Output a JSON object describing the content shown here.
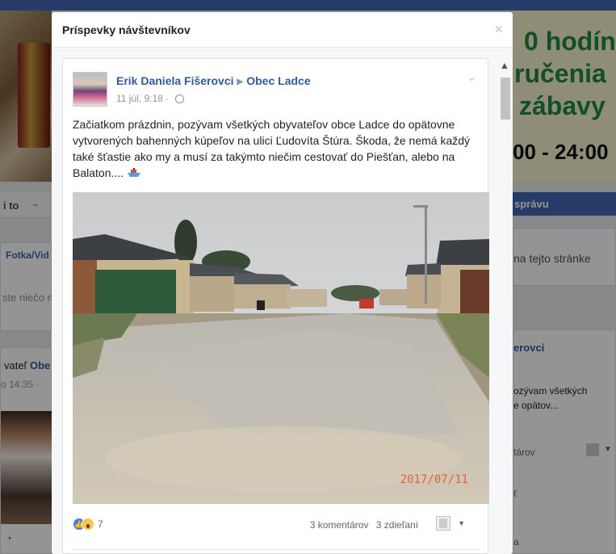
{
  "modal": {
    "title": "Príspevky návštevníkov",
    "close_glyph": "×"
  },
  "post": {
    "author": "Erik Daniela Fišerovci",
    "separator": "▶",
    "target": "Obec Ladce",
    "timestamp": "11 júl, 9:18",
    "dot": "·",
    "privacy_icon": "globe-icon",
    "menu_glyph": "⌄",
    "text": "Začiatkom prázdnin, pozývam všetkých obyvateľov obce Ladce do opätovne vytvorených bahenných kúpeľov na ulici Ľudovíta Štúra. Škoda, že nemá každý také šťastie ako my a musí za takýmto niečim cestovať do Piešťan, alebo na Balaton....",
    "emoji": "boat-emoji",
    "photo_date": "2017/07/11",
    "reactions": {
      "like_glyph": "👍",
      "count": "7",
      "types": [
        "like",
        "wow"
      ]
    },
    "comments": "3 komentárov",
    "shares": "3 zdieľaní"
  },
  "background": {
    "banner_line1": "0 hodín",
    "banner_line2": "ručenia",
    "banner_line3": "zábavy",
    "banner_line4": "00 - 24:00",
    "left_strip_label": "i to",
    "left_card_tab": "Fotka/Vid",
    "left_card_prompt": "ste niečo n",
    "left_post_line": "vateľ",
    "left_post_link": "Obe",
    "left_post_time": "o 14:35 ·",
    "right_button": "správu",
    "right_search": "na tejto stránke",
    "right_author": "erovci",
    "right_preview": "ozývam všetkých\ne opätov...",
    "right_comments": "tárov",
    "right_extra": "ť",
    "right_extra2": "a",
    "accent_color": "#4267b2",
    "link_color": "#365899"
  }
}
